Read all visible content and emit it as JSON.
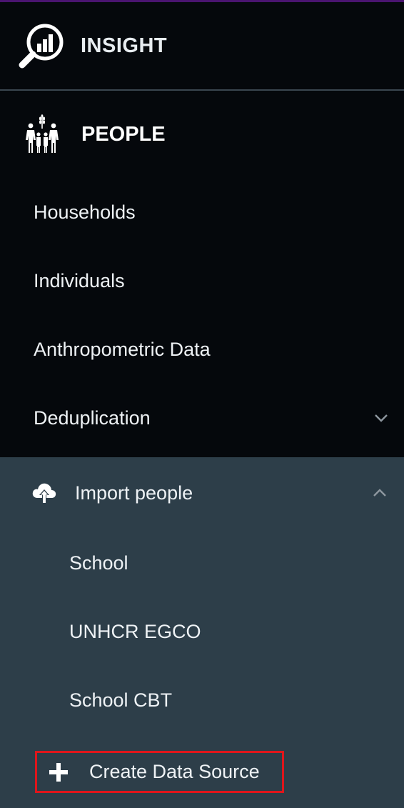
{
  "brand": {
    "title": "INSIGHT",
    "icon": "magnifier-chart-icon"
  },
  "section": {
    "title": "PEOPLE",
    "icon": "family-icon"
  },
  "nav_items": [
    {
      "label": "Households"
    },
    {
      "label": "Individuals"
    },
    {
      "label": "Anthropometric Data"
    },
    {
      "label": "Deduplication",
      "icon": "chevron-down-icon"
    }
  ],
  "import_group": {
    "label": "Import people",
    "icon": "cloud-upload-icon",
    "toggle_icon": "chevron-up-icon",
    "items": [
      {
        "label": "School"
      },
      {
        "label": "UNHCR EGCO"
      },
      {
        "label": "School CBT"
      }
    ],
    "create_button": {
      "label": "Create Data Source",
      "icon": "plus-icon"
    }
  },
  "colors": {
    "sidebar_bg": "#05080c",
    "submenu_bg": "#2d3e49",
    "highlight_border": "#e0161b",
    "top_accent": "#4a1470"
  }
}
